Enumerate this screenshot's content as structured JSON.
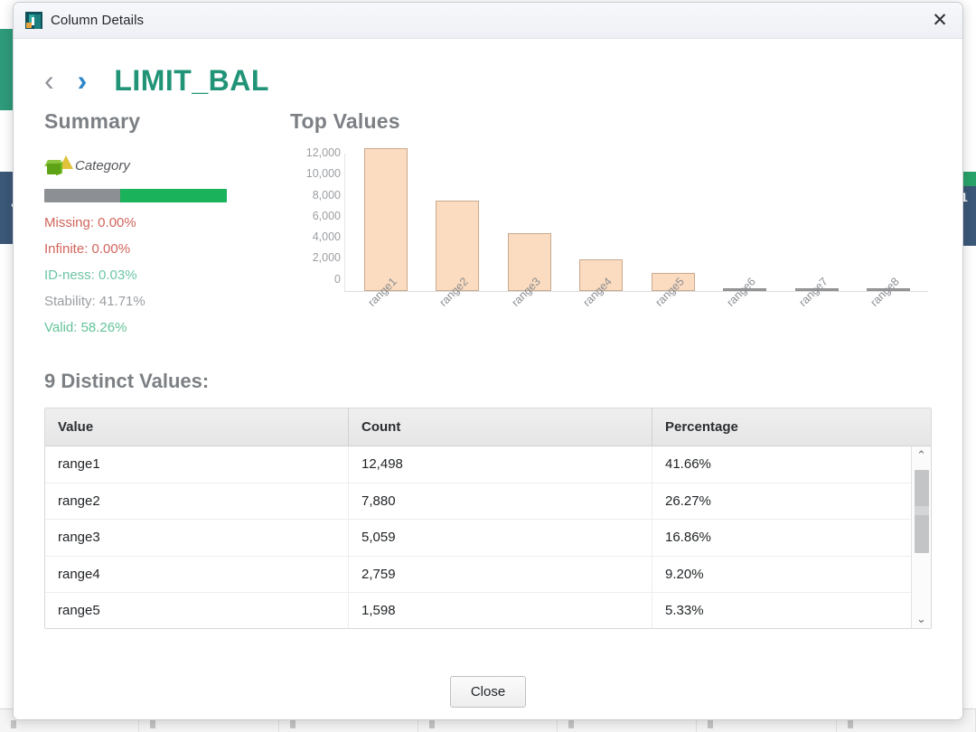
{
  "window": {
    "title": "Column Details",
    "app_icon": "app-window-icon",
    "close_icon": "✕"
  },
  "header": {
    "prev_icon": "‹",
    "next_icon": "›",
    "column_name": "LIMIT_BAL",
    "column_name_color": "#219477"
  },
  "summary": {
    "title": "Summary",
    "type_icon": "cube-icon",
    "type_label": "Category",
    "quality_bar": {
      "gray_pct": 41.71,
      "green_pct": 58.26,
      "gray_color": "#8c9094",
      "green_color": "#1ab25a"
    },
    "stats": [
      {
        "key": "Missing:",
        "value": "0.00%",
        "text": "Missing: 0.00%",
        "color": "#d1655b"
      },
      {
        "key": "Infinite:",
        "value": "0.00%",
        "text": "Infinite: 0.00%",
        "color": "#d1655b"
      },
      {
        "key": "ID-ness:",
        "value": "0.03%",
        "text": "ID-ness: 0.03%",
        "color": "#6ec6a5"
      },
      {
        "key": "Stability:",
        "value": "41.71%",
        "text": "Stability: 41.71%",
        "color": "#9a9ea2"
      },
      {
        "key": "Valid:",
        "value": "58.26%",
        "text": "Valid: 58.26%",
        "color": "#64c39a"
      }
    ]
  },
  "chart_data": {
    "type": "bar",
    "title": "Top Values",
    "categories": [
      "range1",
      "range2",
      "range3",
      "range4",
      "range5",
      "range6",
      "range7",
      "range8"
    ],
    "values": [
      12498,
      7880,
      5059,
      2759,
      1598,
      120,
      60,
      26
    ],
    "xlabel": "",
    "ylabel": "",
    "ylim": [
      0,
      12000
    ],
    "ytick_labels": [
      "12,000",
      "10,000",
      "8,000",
      "6,000",
      "4,000",
      "2,000",
      "0"
    ],
    "yticks": [
      12000,
      10000,
      8000,
      6000,
      4000,
      2000,
      0
    ],
    "grid": false,
    "legend": "none",
    "bar_fill": "#fbdcc0",
    "bar_border": "#c9a98d"
  },
  "distinct": {
    "title": "9 Distinct Values:",
    "columns": [
      "Value",
      "Count",
      "Percentage"
    ],
    "rows": [
      {
        "value": "range1",
        "count": "12,498",
        "percentage": "41.66%"
      },
      {
        "value": "range2",
        "count": "7,880",
        "percentage": "26.27%"
      },
      {
        "value": "range3",
        "count": "5,059",
        "percentage": "16.86%"
      },
      {
        "value": "range4",
        "count": "2,759",
        "percentage": "9.20%"
      },
      {
        "value": "range5",
        "count": "1,598",
        "percentage": "5.33%"
      }
    ],
    "scroll_up_icon": "⌃",
    "scroll_down_icon": "⌄"
  },
  "footer": {
    "close_label": "Close"
  },
  "background": {
    "left_marker": "❮",
    "right_marker": "1"
  }
}
